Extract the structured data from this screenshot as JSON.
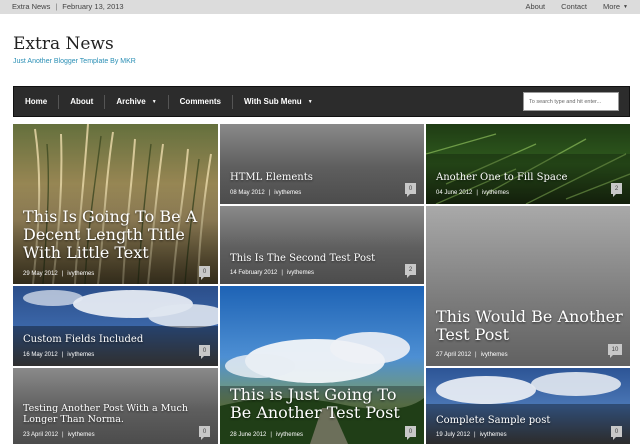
{
  "topbar": {
    "site": "Extra News",
    "date": "February 13, 2013",
    "links": [
      "About",
      "Contact",
      "More"
    ]
  },
  "header": {
    "title": "Extra News",
    "description": "Just Another Blogger Template By MKR"
  },
  "nav": {
    "items": [
      "Home",
      "About",
      "Archive",
      "Comments",
      "With Sub Menu"
    ],
    "search_placeholder": "To search type and hit enter..."
  },
  "posts": [
    {
      "title": "This Is Going To Be A Decent Length Title With Little Text",
      "date": "29 May 2012",
      "author": "ivythemes",
      "comments": "0"
    },
    {
      "title": "HTML Elements",
      "date": "08 May 2012",
      "author": "ivythemes",
      "comments": "0"
    },
    {
      "title": "Another One to Fill Space",
      "date": "04 June 2012",
      "author": "ivythemes",
      "comments": "2"
    },
    {
      "title": "This Is The Second Test Post",
      "date": "14 February 2012",
      "author": "ivythemes",
      "comments": "2"
    },
    {
      "title": "This Would Be Another Test Post",
      "date": "27 April 2012",
      "author": "ivythemes",
      "comments": "10"
    },
    {
      "title": "Custom Fields Included",
      "date": "16 May 2012",
      "author": "ivythemes",
      "comments": "0"
    },
    {
      "title": "This is Just Going To Be Another Test Post",
      "date": "28 June 2012",
      "author": "ivythemes",
      "comments": "0"
    },
    {
      "title": "Testing Another Post With a Much Longer Than Norma.",
      "date": "23 April 2012",
      "author": "ivythemes",
      "comments": "0"
    },
    {
      "title": "Complete Sample post",
      "date": "19 July 2012",
      "author": "ivythemes",
      "comments": "0"
    }
  ],
  "colors": {
    "topbar_bg": "#dcdcdc",
    "nav_bg": "#2c2c2c",
    "accent": "#2a8fb5"
  }
}
